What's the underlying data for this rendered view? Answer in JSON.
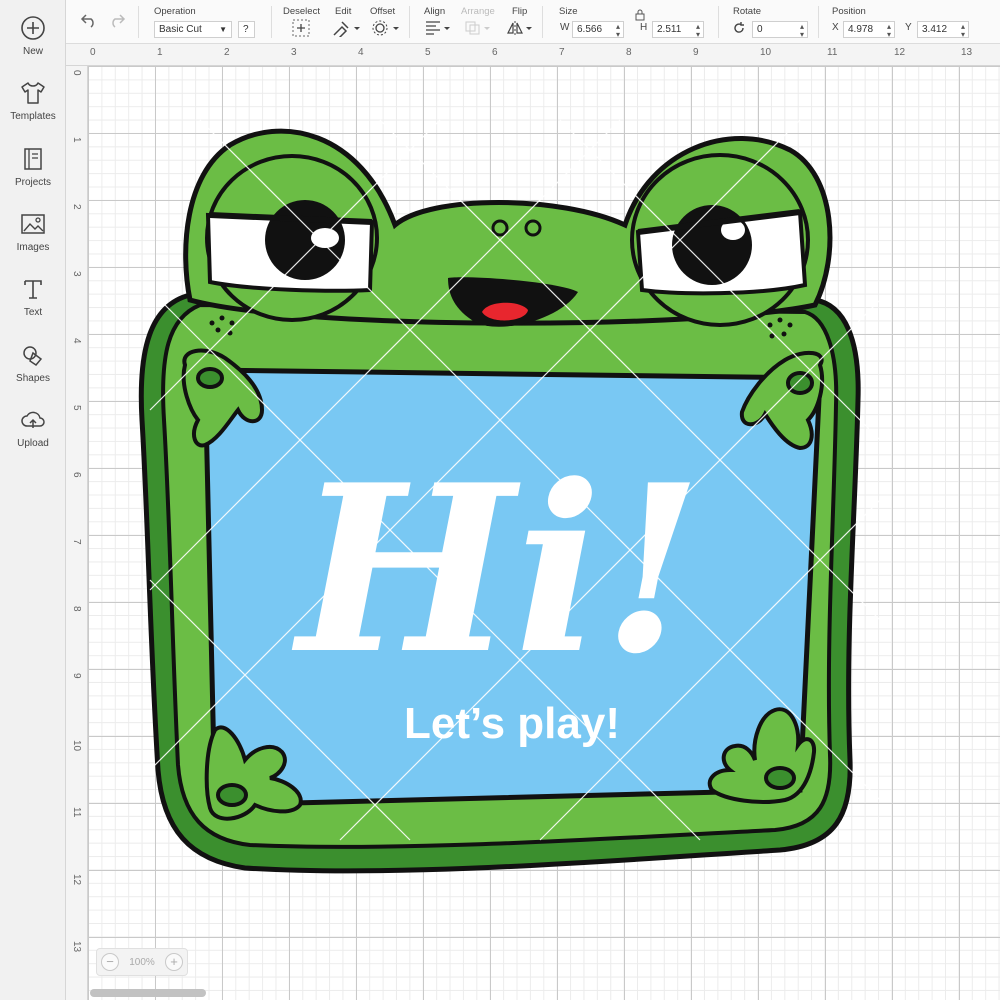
{
  "sidebar": {
    "items": [
      {
        "label": "New",
        "icon": "plus-circle-icon"
      },
      {
        "label": "Templates",
        "icon": "tshirt-icon"
      },
      {
        "label": "Projects",
        "icon": "notebook-icon"
      },
      {
        "label": "Images",
        "icon": "image-icon"
      },
      {
        "label": "Text",
        "icon": "text-icon"
      },
      {
        "label": "Shapes",
        "icon": "shapes-icon"
      },
      {
        "label": "Upload",
        "icon": "cloud-upload-icon"
      }
    ]
  },
  "toolbar": {
    "operation_label": "Operation",
    "operation_value": "Basic Cut",
    "operation_help": "?",
    "deselect_label": "Deselect",
    "edit_label": "Edit",
    "offset_label": "Offset",
    "align_label": "Align",
    "arrange_label": "Arrange",
    "flip_label": "Flip",
    "size_label": "Size",
    "size_w_label": "W",
    "size_w_value": "6.566",
    "size_h_label": "H",
    "size_h_value": "2.511",
    "rotate_label": "Rotate",
    "rotate_value": "0",
    "position_label": "Position",
    "position_x_label": "X",
    "position_x_value": "4.978",
    "position_y_label": "Y",
    "position_y_value": "3.412"
  },
  "ruler": {
    "top_ticks": [
      "0",
      "1",
      "2",
      "3",
      "4",
      "5",
      "6",
      "7",
      "8",
      "9",
      "10",
      "11",
      "12",
      "13"
    ],
    "left_ticks": [
      "0",
      "1",
      "2",
      "3",
      "4",
      "5",
      "6",
      "7",
      "8",
      "9",
      "10",
      "11",
      "12",
      "13"
    ]
  },
  "artwork": {
    "headline": "Hi!",
    "subline": "Let’s play!",
    "colors": {
      "frog_dark": "#3b8f2e",
      "frog_light": "#6bbd45",
      "board": "#79c8f3",
      "outline": "#111111",
      "mouth_red": "#e8262e"
    }
  },
  "zoom": {
    "minus": "−",
    "level": "100%",
    "plus": "+"
  }
}
